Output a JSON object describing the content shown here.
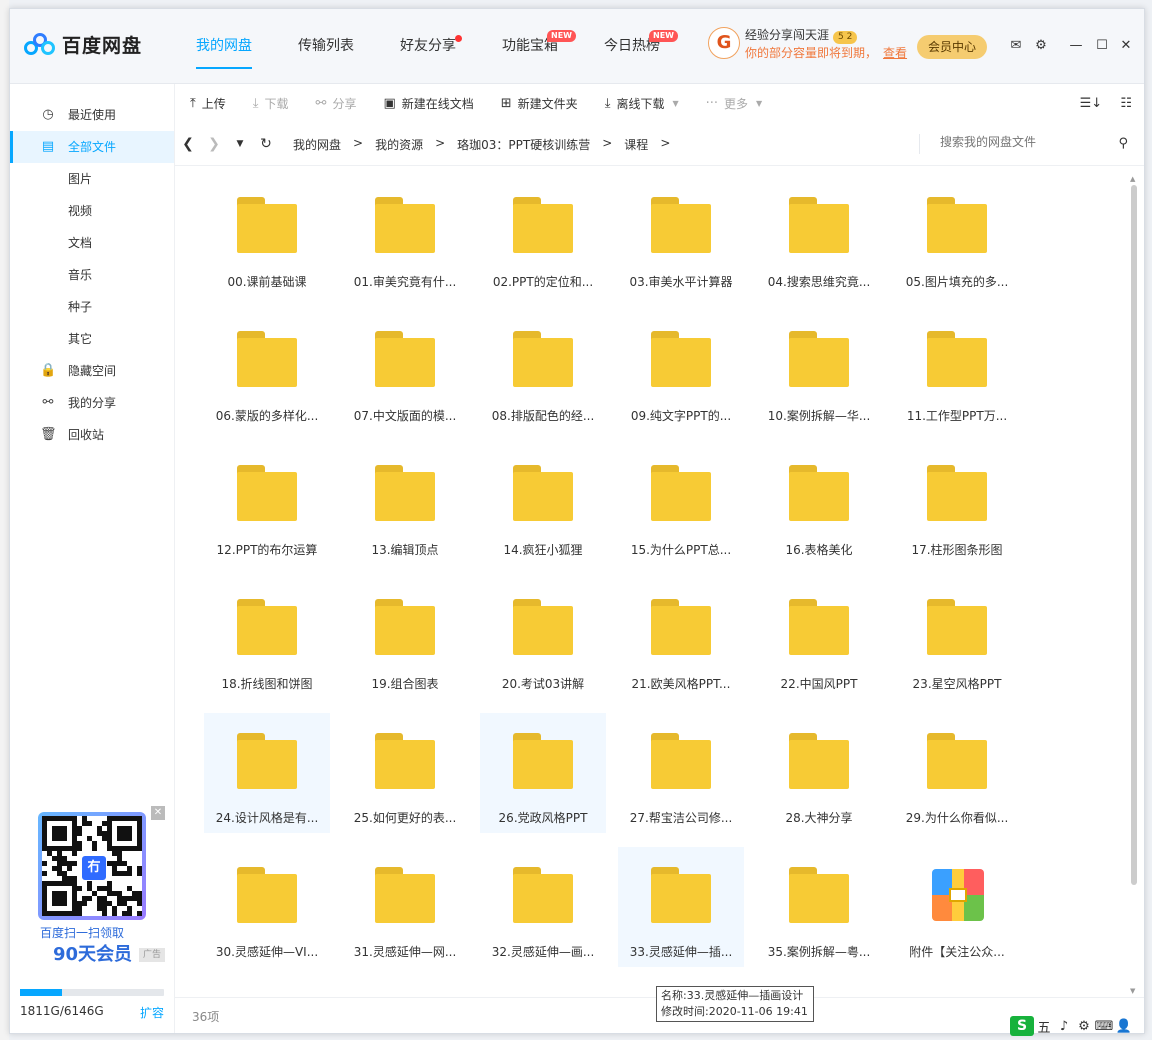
{
  "app": {
    "name": "百度网盘"
  },
  "nav": {
    "items": [
      {
        "label": "我的网盘",
        "active": true,
        "badge": ""
      },
      {
        "label": "传输列表",
        "active": false,
        "badge": ""
      },
      {
        "label": "好友分享",
        "active": false,
        "badge": "dot"
      },
      {
        "label": "功能宝箱",
        "active": false,
        "badge": "NEW"
      },
      {
        "label": "今日热榜",
        "active": false,
        "badge": "NEW"
      }
    ]
  },
  "user": {
    "name": "经验分享闯天涯",
    "level": "5 2",
    "note": "你的部分容量即将到期，",
    "note_link": "查看",
    "vip_button": "会员中心"
  },
  "sidebar": {
    "items": [
      {
        "label": "最近使用",
        "icon": "clock-icon",
        "glyph": "◷",
        "active": false,
        "sub": false
      },
      {
        "label": "全部文件",
        "icon": "file-icon",
        "glyph": "▤",
        "active": true,
        "sub": false
      },
      {
        "label": "图片",
        "icon": "",
        "glyph": "",
        "active": false,
        "sub": true
      },
      {
        "label": "视频",
        "icon": "",
        "glyph": "",
        "active": false,
        "sub": true
      },
      {
        "label": "文档",
        "icon": "",
        "glyph": "",
        "active": false,
        "sub": true
      },
      {
        "label": "音乐",
        "icon": "",
        "glyph": "",
        "active": false,
        "sub": true
      },
      {
        "label": "种子",
        "icon": "",
        "glyph": "",
        "active": false,
        "sub": true
      },
      {
        "label": "其它",
        "icon": "",
        "glyph": "",
        "active": false,
        "sub": true
      },
      {
        "label": "隐藏空间",
        "icon": "lock-icon",
        "glyph": "🔒",
        "active": false,
        "sub": false
      },
      {
        "label": "我的分享",
        "icon": "share-icon",
        "glyph": "⚯",
        "active": false,
        "sub": false
      },
      {
        "label": "回收站",
        "icon": "trash-icon",
        "glyph": "🗑",
        "active": false,
        "sub": false
      }
    ],
    "ad": {
      "line1": "百度扫一扫领取",
      "line2": "90天会员",
      "tag": "广告",
      "badge": "冇"
    },
    "quota": {
      "text": "1811G/6146G",
      "used_fraction": 0.295,
      "link": "扩容"
    }
  },
  "toolbar": {
    "buttons": [
      {
        "label": "上传",
        "icon": "upload-icon",
        "glyph": "⤒",
        "disabled": false,
        "caret": false
      },
      {
        "label": "下载",
        "icon": "download-icon",
        "glyph": "⤓",
        "disabled": true,
        "caret": false
      },
      {
        "label": "分享",
        "icon": "share-icon",
        "glyph": "⚯",
        "disabled": true,
        "caret": false
      },
      {
        "label": "新建在线文档",
        "icon": "doc-icon",
        "glyph": "▣",
        "disabled": false,
        "caret": false
      },
      {
        "label": "新建文件夹",
        "icon": "new-folder-icon",
        "glyph": "⊞",
        "disabled": false,
        "caret": false
      },
      {
        "label": "离线下载",
        "icon": "offline-download-icon",
        "glyph": "⤓",
        "disabled": false,
        "caret": true
      },
      {
        "label": "更多",
        "icon": "more-icon",
        "glyph": "···",
        "disabled": true,
        "caret": true
      }
    ]
  },
  "breadcrumb": {
    "items": [
      "我的网盘",
      "我的资源",
      "珞珈03：PPT硬核训练营",
      "课程"
    ],
    "separator": ">"
  },
  "search": {
    "placeholder": "搜索我的网盘文件"
  },
  "files": [
    {
      "name": "00.课前基础课",
      "type": "folder"
    },
    {
      "name": "01.审美究竟有什...",
      "type": "folder"
    },
    {
      "name": "02.PPT的定位和...",
      "type": "folder"
    },
    {
      "name": "03.审美水平计算器",
      "type": "folder"
    },
    {
      "name": "04.搜索思维究竟...",
      "type": "folder"
    },
    {
      "name": "05.图片填充的多...",
      "type": "folder"
    },
    {
      "name": "06.蒙版的多样化...",
      "type": "folder"
    },
    {
      "name": "07.中文版面的模...",
      "type": "folder"
    },
    {
      "name": "08.排版配色的经...",
      "type": "folder"
    },
    {
      "name": "09.纯文字PPT的...",
      "type": "folder"
    },
    {
      "name": "10.案例拆解—华...",
      "type": "folder"
    },
    {
      "name": "11.工作型PPT万...",
      "type": "folder"
    },
    {
      "name": "12.PPT的布尔运算",
      "type": "folder"
    },
    {
      "name": "13.编辑顶点",
      "type": "folder"
    },
    {
      "name": "14.疯狂小狐狸",
      "type": "folder"
    },
    {
      "name": "15.为什么PPT总...",
      "type": "folder"
    },
    {
      "name": "16.表格美化",
      "type": "folder"
    },
    {
      "name": "17.柱形图条形图",
      "type": "folder"
    },
    {
      "name": "18.折线图和饼图",
      "type": "folder"
    },
    {
      "name": "19.组合图表",
      "type": "folder"
    },
    {
      "name": "20.考试03讲解",
      "type": "folder"
    },
    {
      "name": "21.欧美风格PPT...",
      "type": "folder"
    },
    {
      "name": "22.中国风PPT",
      "type": "folder"
    },
    {
      "name": "23.星空风格PPT",
      "type": "folder"
    },
    {
      "name": "24.设计风格是有...",
      "type": "folder",
      "selected": true
    },
    {
      "name": "25.如何更好的表...",
      "type": "folder"
    },
    {
      "name": "26.党政风格PPT",
      "type": "folder",
      "selected": true
    },
    {
      "name": "27.帮宝洁公司修...",
      "type": "folder"
    },
    {
      "name": "28.大神分享",
      "type": "folder"
    },
    {
      "name": "29.为什么你看似...",
      "type": "folder"
    },
    {
      "name": "30.灵感延伸—VI...",
      "type": "folder"
    },
    {
      "name": "31.灵感延伸—网...",
      "type": "folder"
    },
    {
      "name": "32.灵感延伸—画...",
      "type": "folder"
    },
    {
      "name": "33.灵感延伸—插...",
      "type": "folder",
      "selected": true
    },
    {
      "name": "35.案例拆解—粤...",
      "type": "folder"
    },
    {
      "name": "附件【关注公众...",
      "type": "archive"
    }
  ],
  "footer": {
    "count": "36项"
  },
  "tooltip": {
    "name_line": "名称:33.灵感延伸—插画设计",
    "time_line": "修改时间:2020-11-06 19:41"
  },
  "tray": {
    "ime": "S",
    "items": [
      "五",
      "♪",
      "⚙",
      "⌨",
      "👤"
    ]
  },
  "colors": {
    "accent": "#06a7ff",
    "folder": "#f7cb35",
    "vip": "#f5cc70",
    "warning": "#f0783c"
  }
}
